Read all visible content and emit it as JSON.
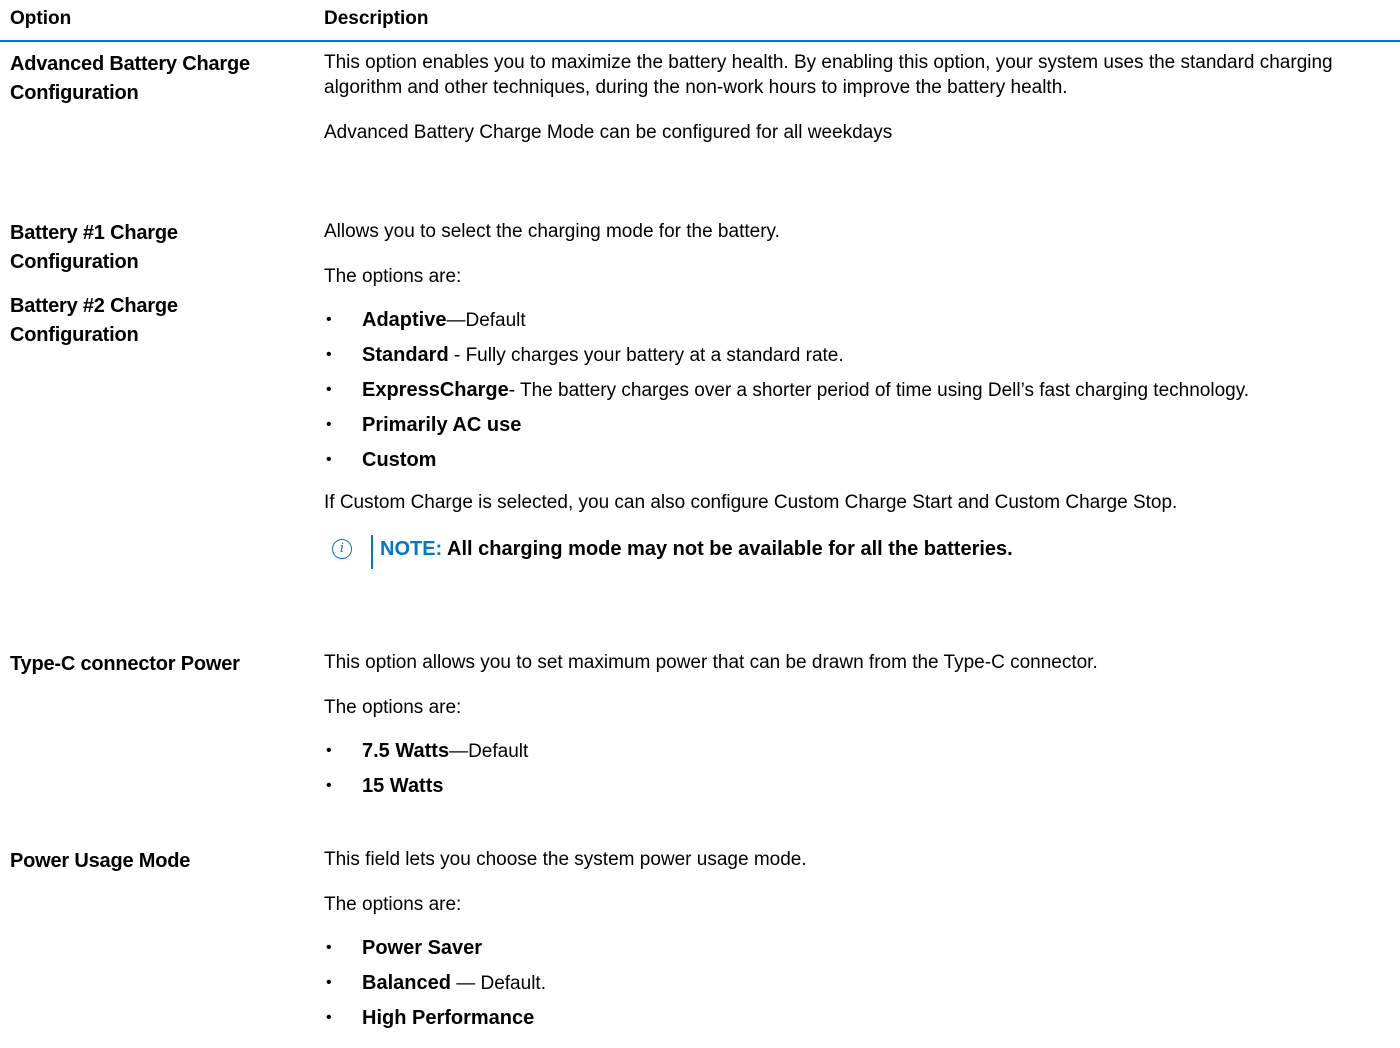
{
  "header": {
    "option": "Option",
    "description": "Description"
  },
  "rows": [
    {
      "labels": [
        "Advanced Battery Charge Configuration"
      ],
      "paragraphs": [
        "This option enables you to maximize the battery health. By enabling this option, your system uses the standard charging algorithm and other techniques, during the non-work hours to improve the battery health.",
        "Advanced Battery Charge Mode can be configured for all weekdays"
      ]
    },
    {
      "labels": [
        "Battery #1 Charge Configuration",
        "Battery #2 Charge Configuration"
      ],
      "intro": "Allows you to select the charging mode for the battery.",
      "options_label": "The options are:",
      "bullets": [
        {
          "bold": "Adaptive",
          "rest": "—Default"
        },
        {
          "bold": "Standard",
          "rest": " - Fully charges your battery at a standard rate."
        },
        {
          "bold": "ExpressCharge",
          "rest": "- The battery charges over a shorter period of time using Dell’s fast charging technology."
        },
        {
          "bold": "Primarily AC use",
          "rest": ""
        },
        {
          "bold": "Custom",
          "rest": ""
        }
      ],
      "after": "If Custom Charge is selected, you can also configure Custom Charge Start and Custom Charge Stop.",
      "note": {
        "label": "NOTE:",
        "text": " All charging mode may not be available for all the batteries.",
        "icon": "info-icon"
      }
    },
    {
      "labels": [
        "Type-C connector Power"
      ],
      "intro": "This option allows you to set maximum power that can be drawn from the Type-C connector.",
      "options_label": "The options are:",
      "bullets": [
        {
          "bold": "7.5 Watts",
          "rest": "—Default"
        },
        {
          "bold": "15 Watts",
          "rest": ""
        }
      ]
    },
    {
      "labels": [
        "Power Usage Mode"
      ],
      "intro": "This field lets you choose the system power usage mode.",
      "options_label": "The options are:",
      "bullets": [
        {
          "bold": "Power Saver",
          "rest": ""
        },
        {
          "bold": "Balanced",
          "rest": " — Default."
        },
        {
          "bold": "High Performance",
          "rest": ""
        }
      ]
    }
  ],
  "colors": {
    "accent": "#0076ce",
    "text": "#000000"
  }
}
